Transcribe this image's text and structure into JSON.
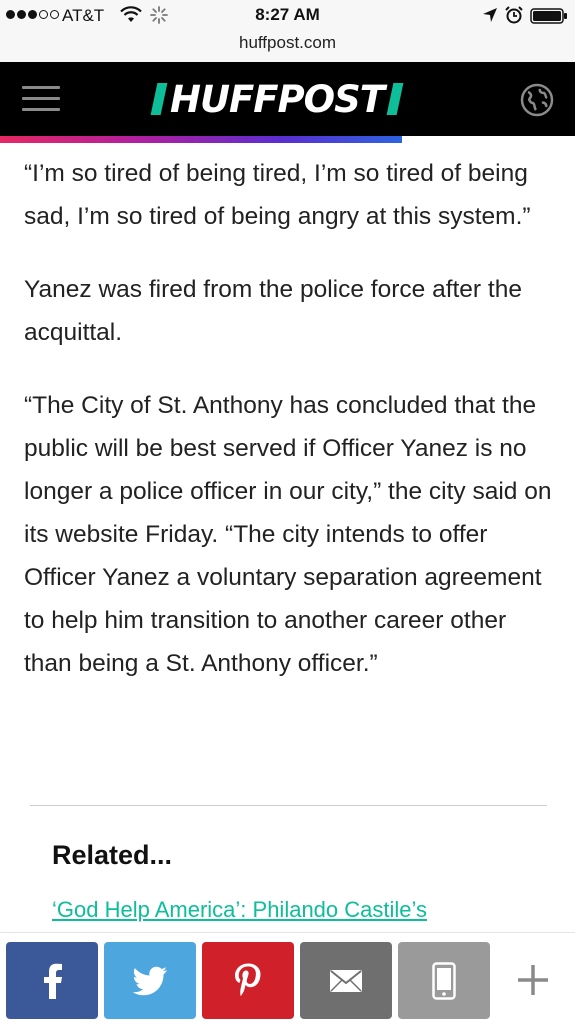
{
  "status_bar": {
    "carrier": "AT&T",
    "time": "8:27 AM",
    "url": "huffpost.com"
  },
  "header": {
    "logo_text": "HUFFPOST"
  },
  "article": {
    "paragraphs": [
      "“I’m so tired of being tired, I’m so tired of being sad, I’m so tired of being angry at this system.”",
      "Yanez was fired from the police force after the acquittal.",
      "“The City of St. Anthony has concluded that the public will be best served if Officer Yanez is no longer a police officer in our city,” the city said on its website Friday. “The city intends to offer Officer Yanez a voluntary separation agreement to help him transition to another career other than being a St. Anthony officer.”"
    ]
  },
  "related": {
    "heading": "Related...",
    "link_text": "‘God Help America’: Philando Castile’s Girlfriend Speaks Out After Cop’s Acquittal"
  },
  "share_bar": {
    "buttons": [
      {
        "name": "facebook",
        "icon": "facebook-icon",
        "color": "#3b5998"
      },
      {
        "name": "twitter",
        "icon": "twitter-icon",
        "color": "#4da7de"
      },
      {
        "name": "pinterest",
        "icon": "pinterest-icon",
        "color": "#d0202a"
      },
      {
        "name": "email",
        "icon": "envelope-icon",
        "color": "#6f6f6f"
      },
      {
        "name": "sms",
        "icon": "phone-icon",
        "color": "#9a9a9a"
      }
    ],
    "more_icon": "plus-icon"
  },
  "colors": {
    "brand_green": "#0dbe98",
    "header_bg": "#000000"
  }
}
